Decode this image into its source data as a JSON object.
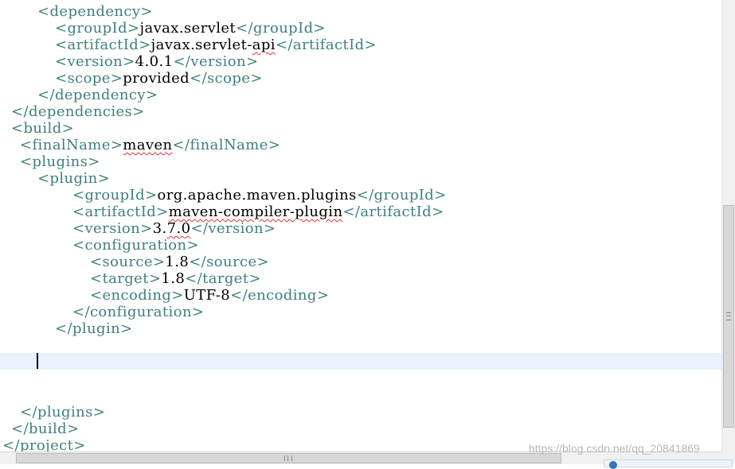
{
  "editor": {
    "lines": [
      {
        "indent": 4,
        "parts": [
          {
            "t": "<dependency>",
            "c": "tag"
          }
        ]
      },
      {
        "indent": 6,
        "parts": [
          {
            "t": "<groupId>",
            "c": "tag"
          },
          {
            "t": "javax.servlet",
            "c": "txt"
          },
          {
            "t": "</groupId>",
            "c": "tag"
          }
        ]
      },
      {
        "indent": 6,
        "parts": [
          {
            "t": "<artifactId>",
            "c": "tag"
          },
          {
            "t": "javax.servlet-",
            "c": "txt"
          },
          {
            "t": "api",
            "c": "txt",
            "s": true
          },
          {
            "t": "</artifactId>",
            "c": "tag"
          }
        ]
      },
      {
        "indent": 6,
        "parts": [
          {
            "t": "<version>",
            "c": "tag"
          },
          {
            "t": "4.0.1",
            "c": "txt"
          },
          {
            "t": "</version>",
            "c": "tag"
          }
        ]
      },
      {
        "indent": 6,
        "parts": [
          {
            "t": "<scope>",
            "c": "tag"
          },
          {
            "t": "provided",
            "c": "txt"
          },
          {
            "t": "</scope>",
            "c": "tag"
          }
        ]
      },
      {
        "indent": 4,
        "parts": [
          {
            "t": "</dependency>",
            "c": "tag"
          }
        ]
      },
      {
        "indent": 1,
        "parts": [
          {
            "t": "</dependencies>",
            "c": "tag"
          }
        ]
      },
      {
        "indent": 1,
        "parts": [
          {
            "t": "<build>",
            "c": "tag"
          }
        ]
      },
      {
        "indent": 2,
        "parts": [
          {
            "t": "<finalName>",
            "c": "tag"
          },
          {
            "t": "maven",
            "c": "txt",
            "s": true
          },
          {
            "t": "</finalName>",
            "c": "tag"
          }
        ]
      },
      {
        "indent": 2,
        "parts": [
          {
            "t": "<plugins>",
            "c": "tag"
          }
        ]
      },
      {
        "indent": 4,
        "parts": [
          {
            "t": "<plugin>",
            "c": "tag"
          }
        ]
      },
      {
        "indent": 8,
        "parts": [
          {
            "t": "<groupId>",
            "c": "tag"
          },
          {
            "t": "org.apache.maven.plugins",
            "c": "txt"
          },
          {
            "t": "</groupId>",
            "c": "tag"
          }
        ]
      },
      {
        "indent": 8,
        "parts": [
          {
            "t": "<artifactId>",
            "c": "tag"
          },
          {
            "t": "maven-compiler-plugin",
            "c": "txt",
            "s": true
          },
          {
            "t": "</artifactId>",
            "c": "tag"
          }
        ]
      },
      {
        "indent": 8,
        "parts": [
          {
            "t": "<version>",
            "c": "tag"
          },
          {
            "t": "3.",
            "c": "txt"
          },
          {
            "t": "7.0",
            "c": "txt",
            "s": true
          },
          {
            "t": "</version>",
            "c": "tag"
          }
        ]
      },
      {
        "indent": 8,
        "parts": [
          {
            "t": "<configuration>",
            "c": "tag"
          }
        ]
      },
      {
        "indent": 10,
        "parts": [
          {
            "t": "<source>",
            "c": "tag"
          },
          {
            "t": "1.8",
            "c": "txt"
          },
          {
            "t": "</source>",
            "c": "tag"
          }
        ]
      },
      {
        "indent": 10,
        "parts": [
          {
            "t": "<target>",
            "c": "tag"
          },
          {
            "t": "1.8",
            "c": "txt"
          },
          {
            "t": "</target>",
            "c": "tag"
          }
        ]
      },
      {
        "indent": 10,
        "parts": [
          {
            "t": "<encoding>",
            "c": "tag"
          },
          {
            "t": "UTF-8",
            "c": "txt"
          },
          {
            "t": "</encoding>",
            "c": "tag"
          }
        ]
      },
      {
        "indent": 8,
        "parts": [
          {
            "t": "</configuration>",
            "c": "tag"
          }
        ]
      },
      {
        "indent": 6,
        "parts": [
          {
            "t": "</plugin>",
            "c": "tag"
          }
        ]
      },
      {
        "indent": 0,
        "parts": []
      },
      {
        "indent": 0,
        "parts": []
      },
      {
        "indent": 0,
        "parts": []
      },
      {
        "indent": 0,
        "parts": []
      },
      {
        "indent": 2,
        "parts": [
          {
            "t": "</plugins>",
            "c": "tag"
          }
        ]
      },
      {
        "indent": 1,
        "parts": [
          {
            "t": "</build>",
            "c": "tag"
          }
        ]
      },
      {
        "indent": 0,
        "parts": [
          {
            "t": "</project>",
            "c": "tag"
          }
        ]
      }
    ]
  },
  "watermark": "https://blog.csdn.net/qq_20841869",
  "colors": {
    "tag": "#3f7f7f",
    "text": "#000000",
    "current_line": "#e8f2fe",
    "spell_error": "#e03030"
  }
}
